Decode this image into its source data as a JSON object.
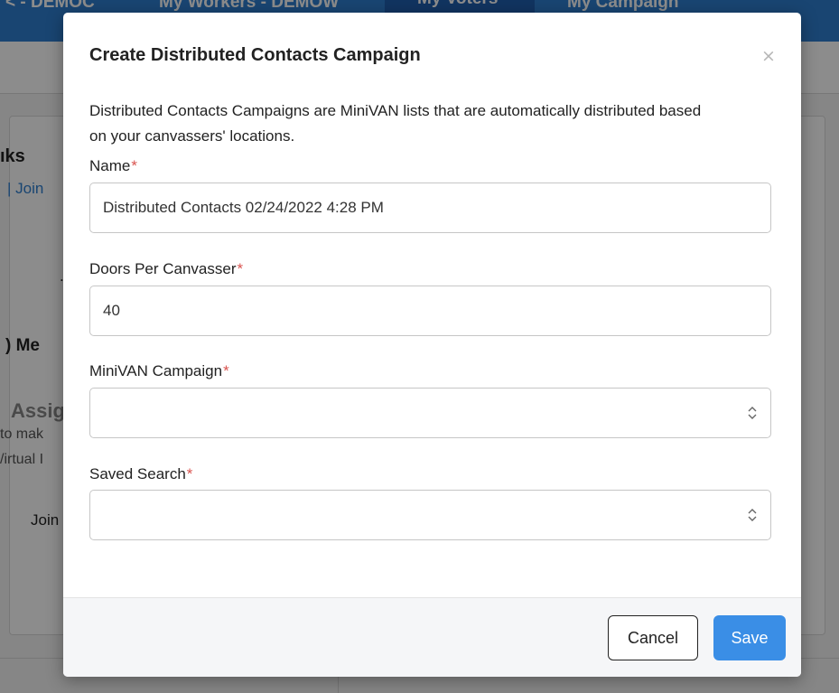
{
  "background": {
    "nav_tabs": [
      "< - DEMOC",
      "My Workers - DEMOW",
      "My Voters",
      "My Campaign"
    ],
    "links_title": "ıks",
    "join_link": "| Join",
    "me_text": ") Me",
    "assign_text": "Assig",
    "make_text": "to mak",
    "virtual_text": "/irtual I",
    "join_text": "Join",
    "dot_text": "."
  },
  "modal": {
    "title": "Create Distributed Contacts Campaign",
    "close_label": "×",
    "description": "Distributed Contacts Campaigns are MiniVAN lists that are automatically distributed based on your canvassers' locations.",
    "required_marker": "*",
    "fields": {
      "name": {
        "label": "Name",
        "value": "Distributed Contacts 02/24/2022 4:28 PM"
      },
      "doors": {
        "label": "Doors Per Canvasser",
        "value": "40"
      },
      "minivan_campaign": {
        "label": "MiniVAN Campaign",
        "value": ""
      },
      "saved_search": {
        "label": "Saved Search",
        "value": ""
      }
    },
    "buttons": {
      "cancel": "Cancel",
      "save": "Save"
    }
  },
  "colors": {
    "nav": "#2f7fd0",
    "primary": "#3a8ee6",
    "required": "#d9534f"
  }
}
